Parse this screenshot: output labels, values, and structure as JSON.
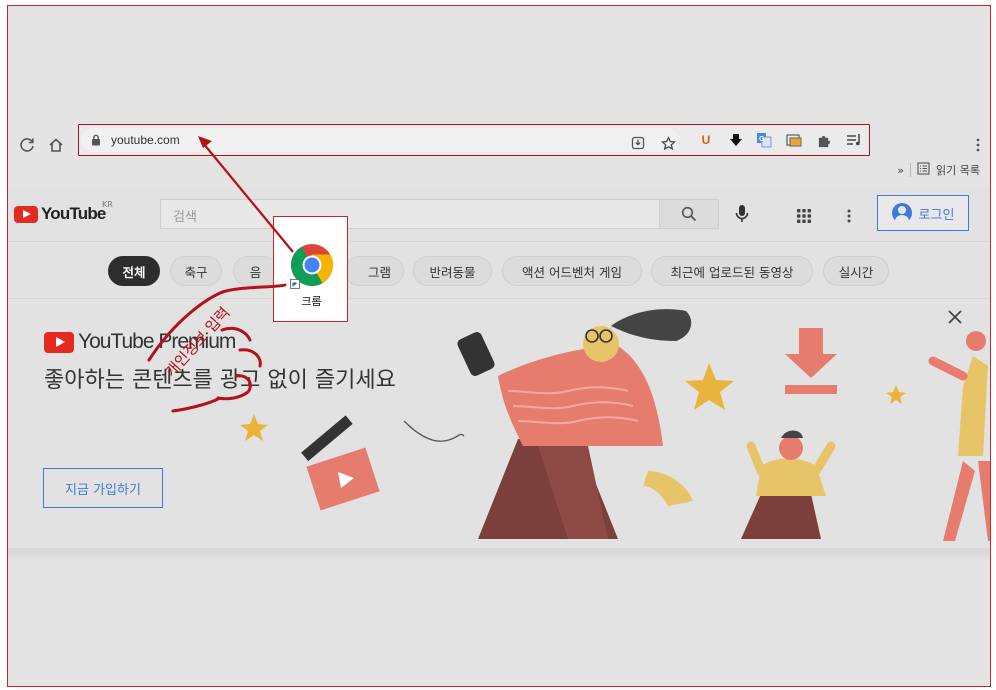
{
  "browser": {
    "url": "youtube.com",
    "bookmarks_overflow": "»",
    "reading_list_label": "읽기 목록"
  },
  "youtube": {
    "logo_text": "YouTube",
    "region": "KR",
    "search_placeholder": "검색",
    "login_label": "로그인",
    "chips": [
      "전체",
      "축구",
      "음",
      "그램",
      "반려동물",
      "액션 어드벤처 게임",
      "최근에 업로드된 동영상",
      "실시간"
    ],
    "premium_logo": "YouTube Premium",
    "tagline": "좋아하는 콘텐츠를 광고 없이 즐기세요",
    "join_label": "지금 가입하기"
  },
  "desktop_shortcut": {
    "label": "크롬"
  },
  "annotation": {
    "handwritten_text": "개인정보 입력"
  },
  "colors": {
    "annotation_red": "#b5111a",
    "youtube_red": "#e32b22",
    "link_blue": "#3f7ad9"
  }
}
